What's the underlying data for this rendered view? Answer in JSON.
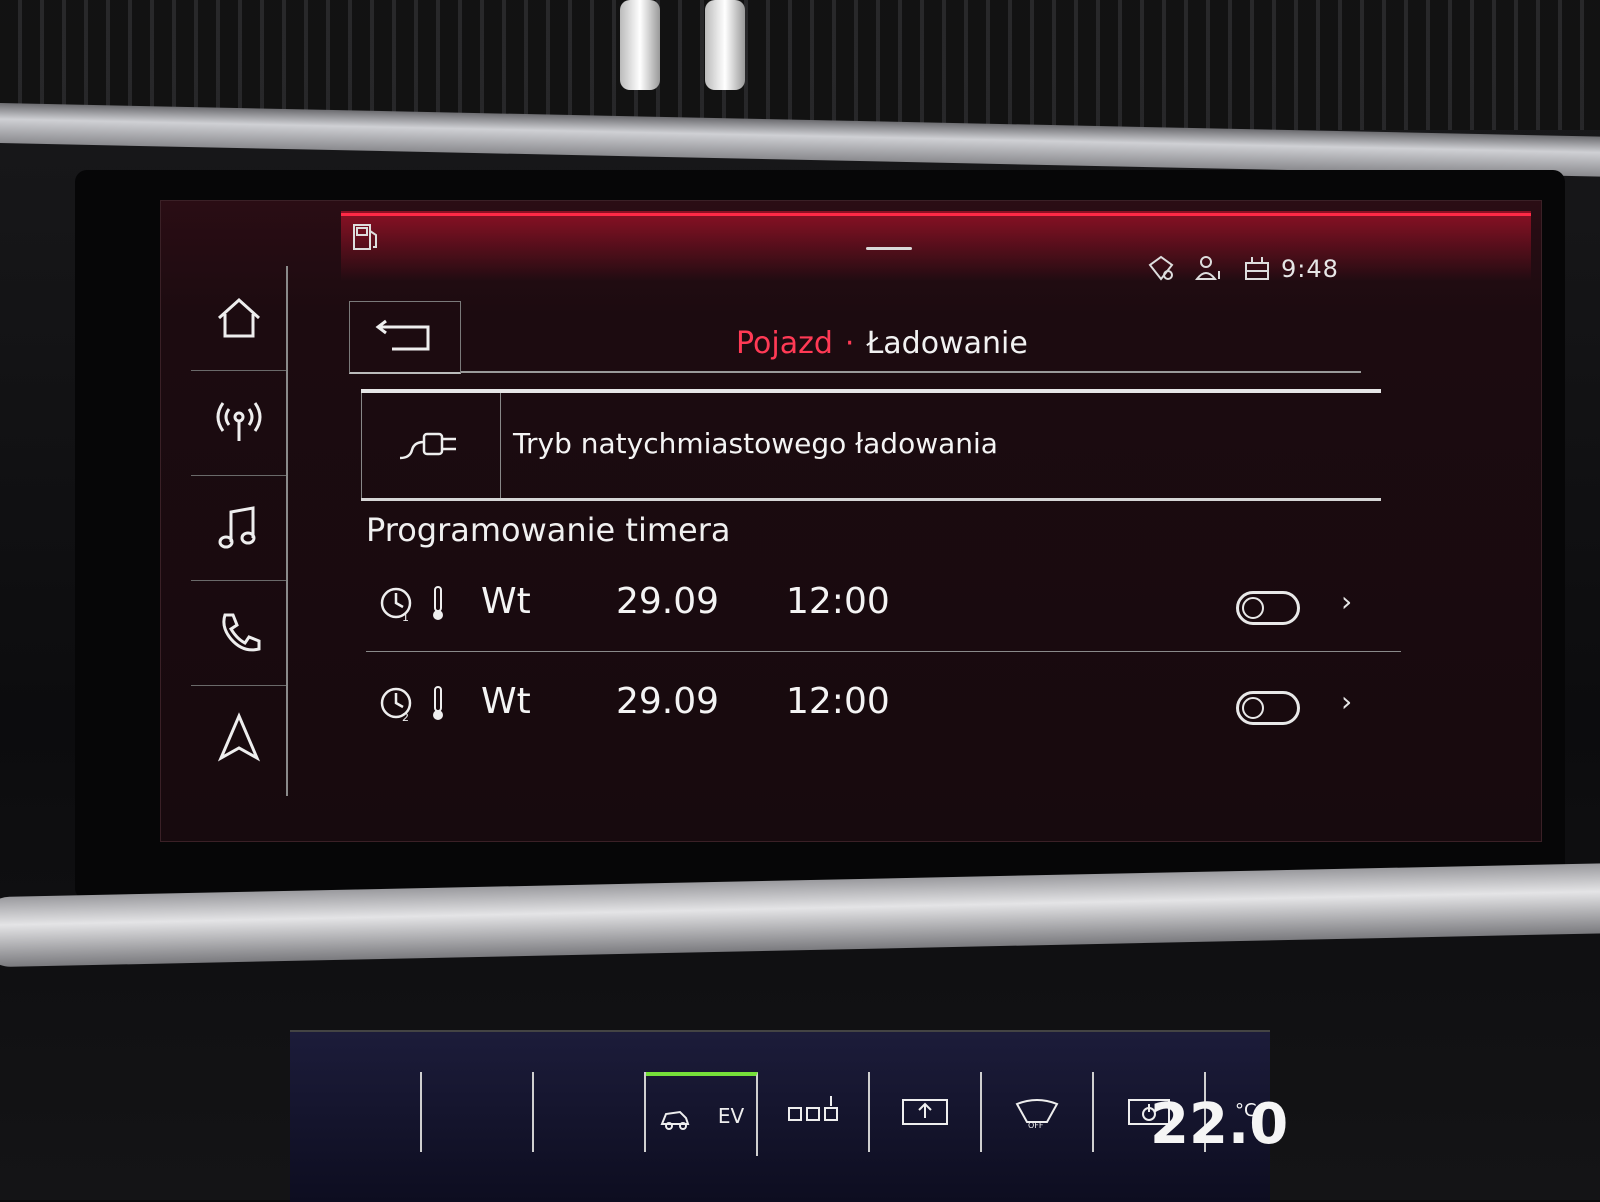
{
  "status_bar": {
    "time": "9:48",
    "icons": [
      "fuel-icon",
      "wifi-hotspot-icon",
      "user-icon",
      "connection-icon"
    ]
  },
  "sidebar": {
    "items": [
      {
        "name": "home",
        "icon": "home-icon"
      },
      {
        "name": "radio",
        "icon": "radio-icon"
      },
      {
        "name": "media",
        "icon": "music-note-icon"
      },
      {
        "name": "phone",
        "icon": "phone-icon"
      },
      {
        "name": "navigation",
        "icon": "navigation-arrow-icon"
      }
    ]
  },
  "header": {
    "breadcrumb_parent": "Pojazd",
    "breadcrumb_separator": "·",
    "breadcrumb_current": "Ładowanie",
    "back_icon": "back-arrow-icon"
  },
  "charge_mode": {
    "label": "Tryb natychmiastowego ładowania",
    "icon": "charging-plug-icon"
  },
  "timers": {
    "title": "Programowanie timera",
    "rows": [
      {
        "index": "1",
        "day": "Wt",
        "date": "29.09",
        "time": "12:00",
        "enabled": false
      },
      {
        "index": "2",
        "day": "Wt",
        "date": "29.09",
        "time": "12:00",
        "enabled": false
      }
    ]
  },
  "climate_bar": {
    "ev_label": "EV",
    "off_label": "OFF",
    "temperature": "22.0",
    "unit": "°C"
  },
  "colors": {
    "accent": "#ff3a55",
    "text": "#f2f2f2",
    "ev_active": "#76e03a"
  }
}
